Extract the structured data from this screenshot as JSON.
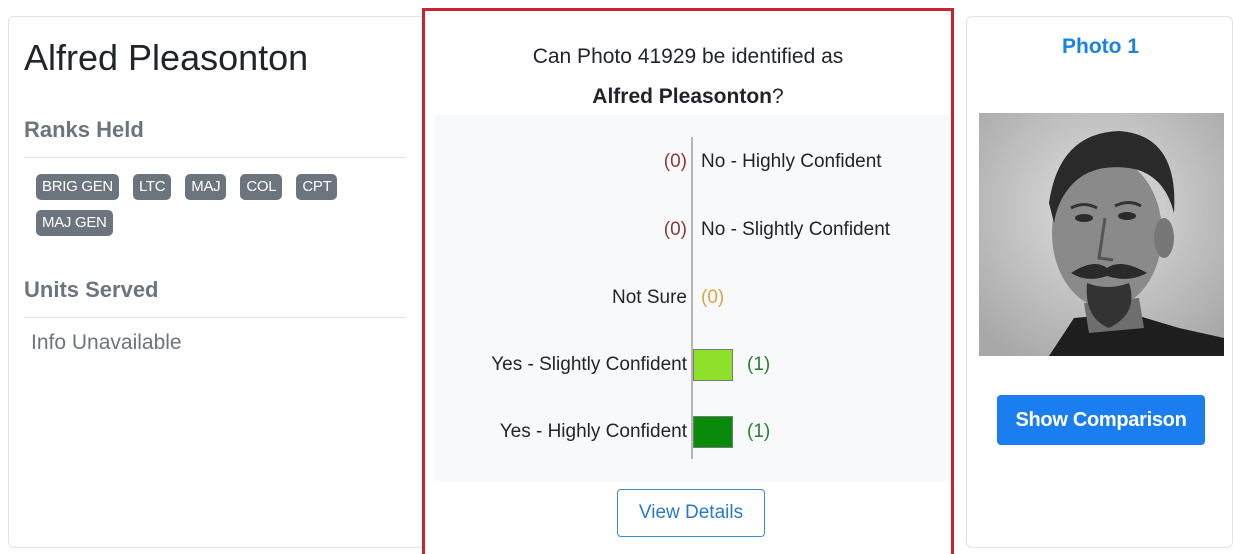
{
  "soldier": {
    "name": "Alfred Pleasonton",
    "ranks_title": "Ranks Held",
    "ranks": [
      "BRIG GEN",
      "LTC",
      "MAJ",
      "COL",
      "CPT",
      "MAJ GEN"
    ],
    "units_title": "Units Served",
    "units_value": "Info Unavailable"
  },
  "vote": {
    "question_prefix": "Can Photo 41929 be identified as",
    "question_name": "Alfred Pleasonton",
    "question_suffix": "?",
    "options": [
      {
        "label": "No - Highly Confident",
        "count_text": "(0)",
        "count": 0,
        "color": "#8b3a3a"
      },
      {
        "label": "No - Slightly Confident",
        "count_text": "(0)",
        "count": 0,
        "color": "#8b3a3a"
      },
      {
        "label": "Not Sure",
        "count_text": "(0)",
        "count": 0,
        "color": "#d9a64a"
      },
      {
        "label": "Yes - Slightly Confident",
        "count_text": "(1)",
        "count": 1,
        "color": "#8fe02a"
      },
      {
        "label": "Yes - Highly Confident",
        "count_text": "(1)",
        "count": 1,
        "color": "#0a8a0a"
      }
    ],
    "count_text_color_yes": "#2e7d32",
    "view_details_label": "View Details"
  },
  "photo_panel": {
    "title": "Photo 1",
    "compare_label": "Show Comparison"
  },
  "colors": {
    "accent": "#1a7ef0",
    "highlight_border": "#c82333",
    "badge": "#6c757d"
  }
}
